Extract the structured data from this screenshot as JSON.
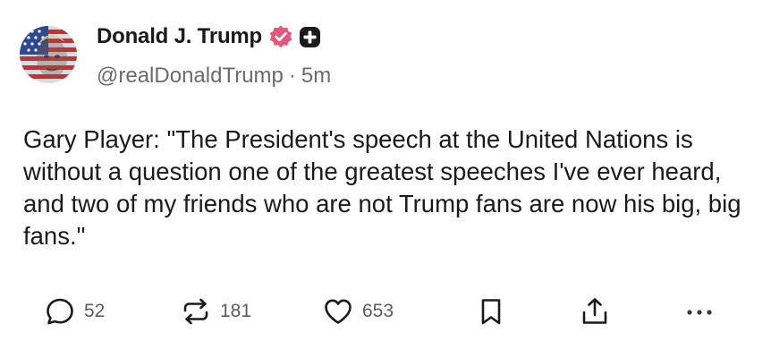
{
  "post": {
    "author": {
      "display_name": "Donald J. Trump",
      "handle": "@realDonaldTrump",
      "separator": "·",
      "time": "5m",
      "verified_color": "#e8557a",
      "avatar_icon": "american-flag-portrait-avatar",
      "badge_icon": "plus-badge-icon"
    },
    "text": "Gary Player: \"The President's speech at the United Nations is without a question one of the greatest speeches I've ever heard, and two of my friends who are not Trump fans are now his big, big fans.\"",
    "actions": {
      "replies": "52",
      "reposts": "181",
      "likes": "653",
      "reply_icon": "reply-bubble-icon",
      "repost_icon": "repost-icon",
      "like_icon": "heart-icon",
      "save_icon": "bookmark-icon",
      "share_icon": "share-icon",
      "more_icon": "more-dots-icon"
    }
  }
}
